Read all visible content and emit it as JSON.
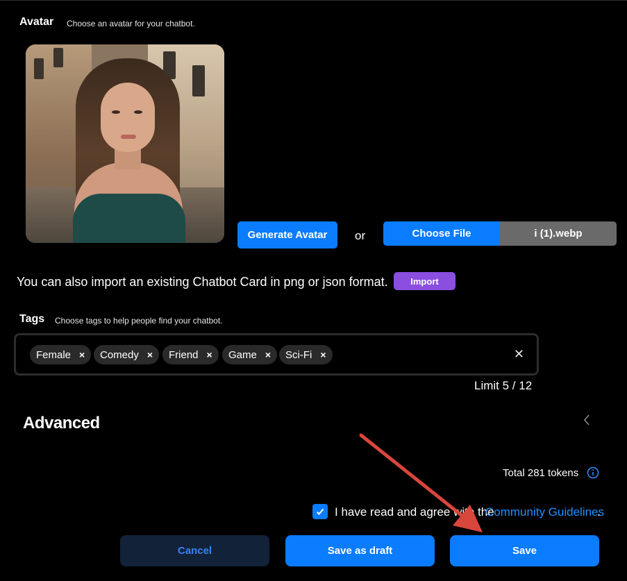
{
  "avatar": {
    "title": "Avatar",
    "hint": "Choose an avatar for your chatbot.",
    "generate_label": "Generate Avatar",
    "or_label": "or",
    "choose_file_label": "Choose File",
    "file_name": "i (1).webp"
  },
  "import": {
    "text": "You can also import an existing Chatbot Card in png or json format.",
    "button_label": "Import"
  },
  "tags": {
    "title": "Tags",
    "hint": "Choose tags to help people find your chatbot.",
    "items": [
      "Female",
      "Comedy",
      "Friend",
      "Game",
      "Sci-Fi"
    ],
    "remove_glyph": "×",
    "clear_glyph": "✕",
    "limit_text": "Limit 5 / 12"
  },
  "advanced": {
    "title": "Advanced"
  },
  "tokens": {
    "text": "Total 281 tokens"
  },
  "agreement": {
    "checked": true,
    "text": "I have read and agree with the",
    "link_label": "Community Guidelines",
    "end": "."
  },
  "actions": {
    "cancel_label": "Cancel",
    "draft_label": "Save as draft",
    "save_label": "Save"
  },
  "colors": {
    "primary": "#0a7cff",
    "import_purple": "#8a4ee0",
    "link": "#1e90ff",
    "annotation_arrow": "#d9463c"
  },
  "icons": {
    "collapse": "chevron-left-icon",
    "info": "info-icon",
    "check": "check-icon"
  }
}
